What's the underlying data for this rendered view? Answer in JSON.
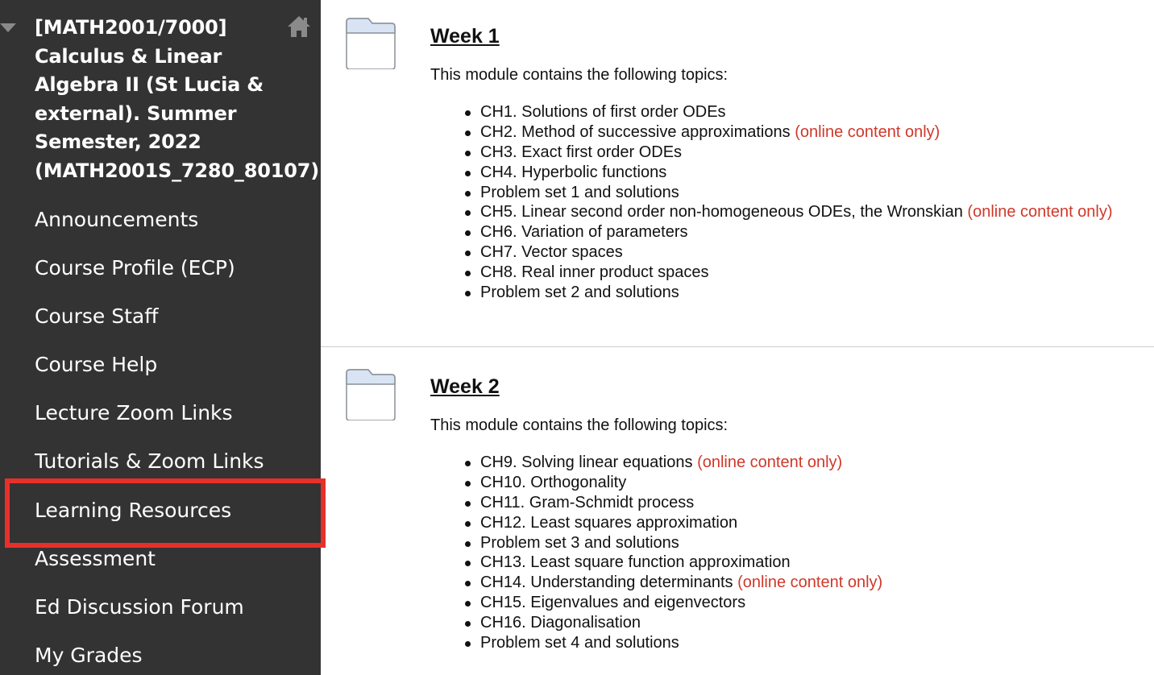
{
  "sidebar": {
    "course_title": "[MATH2001/7000] Calculus & Linear Algebra II (St Lucia & external). Summer Semester, 2022 (MATH2001S_7280_80107)",
    "items": [
      {
        "label": "Announcements"
      },
      {
        "label": "Course Profile (ECP)"
      },
      {
        "label": "Course Staff"
      },
      {
        "label": "Course Help"
      },
      {
        "label": "Lecture Zoom Links"
      },
      {
        "label": "Tutorials & Zoom Links"
      },
      {
        "label": "Learning Resources",
        "highlighted": true
      },
      {
        "label": "Assessment"
      },
      {
        "label": "Ed Discussion Forum"
      },
      {
        "label": "My Grades"
      }
    ],
    "highlight_color": "#e8302a",
    "background": "#333333"
  },
  "weeks": [
    {
      "title": "Week 1",
      "intro": "This module contains the following topics:",
      "topics": [
        {
          "text": "CH1. Solutions of first order ODEs",
          "note": ""
        },
        {
          "text": "CH2. Method of successive approximations",
          "note": "(online content only)"
        },
        {
          "text": "CH3. Exact first order ODEs",
          "note": ""
        },
        {
          "text": "CH4. Hyperbolic functions",
          "note": ""
        },
        {
          "text": "Problem set 1 and solutions",
          "note": ""
        },
        {
          "text": "CH5. Linear second order non-homogeneous ODEs, the Wronskian",
          "note": "(online content only)"
        },
        {
          "text": "CH6. Variation of parameters",
          "note": ""
        },
        {
          "text": "CH7. Vector spaces",
          "note": ""
        },
        {
          "text": "CH8. Real inner product spaces",
          "note": ""
        },
        {
          "text": "Problem set 2 and solutions",
          "note": ""
        }
      ]
    },
    {
      "title": "Week 2",
      "intro": "This module contains the following topics:",
      "topics": [
        {
          "text": "CH9. Solving linear equations",
          "note": "(online content only)"
        },
        {
          "text": "CH10. Orthogonality",
          "note": ""
        },
        {
          "text": "CH11. Gram-Schmidt process",
          "note": ""
        },
        {
          "text": "CH12. Least squares approximation",
          "note": ""
        },
        {
          "text": "Problem set 3 and solutions",
          "note": ""
        },
        {
          "text": "CH13. Least square function approximation",
          "note": ""
        },
        {
          "text": "CH14. Understanding determinants",
          "note": "(online content only)"
        },
        {
          "text": "CH15. Eigenvalues and eigenvectors",
          "note": ""
        },
        {
          "text": "CH16. Diagonalisation",
          "note": ""
        },
        {
          "text": "Problem set 4 and solutions",
          "note": ""
        }
      ]
    }
  ],
  "note_color": "#d0382a"
}
